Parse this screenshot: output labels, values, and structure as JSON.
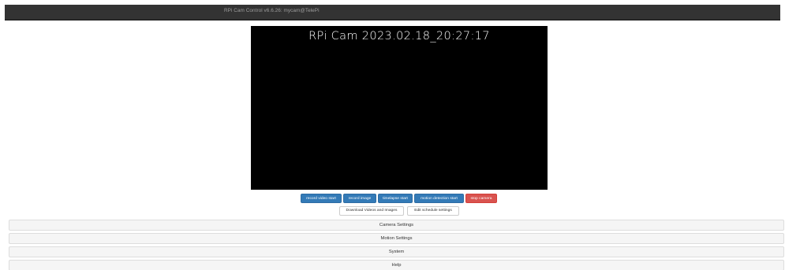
{
  "header": {
    "title": "RPi Cam Control v6.6.26: mycam@TelePi"
  },
  "preview": {
    "overlay_text": "RPi Cam  2023.02.18_20:27:17"
  },
  "controls": {
    "record_video_start": "record video start",
    "record_image": "record image",
    "timelapse_start": "timelapse start",
    "motion_detection_start": "motion detection start",
    "stop_camera": "stop camera",
    "download_videos_and_images": "Download Videos and Images",
    "edit_schedule_settings": "Edit schedule settings"
  },
  "panels": {
    "camera_settings": "Camera Settings",
    "motion_settings": "Motion Settings",
    "system": "System",
    "help": "Help"
  },
  "colors": {
    "navbar": "#333333",
    "primary_button": "#337ab7",
    "danger_button": "#d9534f",
    "panel_background": "#f5f5f5"
  }
}
